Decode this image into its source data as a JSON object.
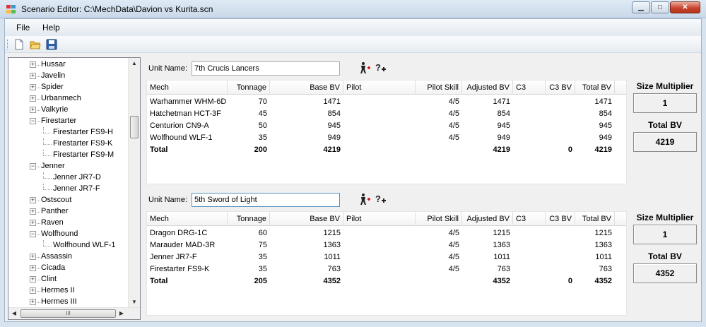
{
  "window": {
    "title": "Scenario Editor: C:\\MechData\\Davion vs Kurita.scn",
    "min_glyph": "▁",
    "max_glyph": "□",
    "close_glyph": "✕"
  },
  "menu": {
    "file": "File",
    "help": "Help"
  },
  "toolbar": {
    "icons": [
      "new-document-icon",
      "open-folder-icon",
      "save-disk-icon"
    ]
  },
  "tree": {
    "items": [
      {
        "label": "Hussar",
        "level": 0,
        "state": "collapsed"
      },
      {
        "label": "Javelin",
        "level": 0,
        "state": "collapsed"
      },
      {
        "label": "Spider",
        "level": 0,
        "state": "collapsed"
      },
      {
        "label": "Urbanmech",
        "level": 0,
        "state": "collapsed"
      },
      {
        "label": "Valkyrie",
        "level": 0,
        "state": "collapsed"
      },
      {
        "label": "Firestarter",
        "level": 0,
        "state": "expanded"
      },
      {
        "label": "Firestarter FS9-H",
        "level": 1,
        "state": "leaf"
      },
      {
        "label": "Firestarter FS9-K",
        "level": 1,
        "state": "leaf"
      },
      {
        "label": "Firestarter FS9-M",
        "level": 1,
        "state": "leaf"
      },
      {
        "label": "Jenner",
        "level": 0,
        "state": "expanded"
      },
      {
        "label": "Jenner JR7-D",
        "level": 1,
        "state": "leaf"
      },
      {
        "label": "Jenner JR7-F",
        "level": 1,
        "state": "leaf"
      },
      {
        "label": "Ostscout",
        "level": 0,
        "state": "collapsed"
      },
      {
        "label": "Panther",
        "level": 0,
        "state": "collapsed"
      },
      {
        "label": "Raven",
        "level": 0,
        "state": "collapsed"
      },
      {
        "label": "Wolfhound",
        "level": 0,
        "state": "expanded"
      },
      {
        "label": "Wolfhound WLF-1",
        "level": 1,
        "state": "leaf"
      },
      {
        "label": "Assassin",
        "level": 0,
        "state": "collapsed"
      },
      {
        "label": "Cicada",
        "level": 0,
        "state": "collapsed"
      },
      {
        "label": "Clint",
        "level": 0,
        "state": "collapsed"
      },
      {
        "label": "Hermes II",
        "level": 0,
        "state": "collapsed"
      },
      {
        "label": "Hermes III",
        "level": 0,
        "state": "collapsed"
      }
    ],
    "hscroll_grip": "III"
  },
  "columns": [
    "Mech",
    "Tonnage",
    "Base BV",
    "Pilot",
    "Pilot Skill",
    "Adjusted BV",
    "C3",
    "C3 BV",
    "Total BV"
  ],
  "units": [
    {
      "label": "Unit Name:",
      "name": "7th Crucis Lancers",
      "rows": [
        {
          "mech": "Warhammer WHM-6D",
          "tonnage": "70",
          "base_bv": "1471",
          "pilot": "",
          "skill": "4/5",
          "adj_bv": "1471",
          "c3": "",
          "c3_bv": "",
          "total_bv": "1471"
        },
        {
          "mech": "Hatchetman HCT-3F",
          "tonnage": "45",
          "base_bv": "854",
          "pilot": "",
          "skill": "4/5",
          "adj_bv": "854",
          "c3": "",
          "c3_bv": "",
          "total_bv": "854"
        },
        {
          "mech": "Centurion CN9-A",
          "tonnage": "50",
          "base_bv": "945",
          "pilot": "",
          "skill": "4/5",
          "adj_bv": "945",
          "c3": "",
          "c3_bv": "",
          "total_bv": "945"
        },
        {
          "mech": "Wolfhound WLF-1",
          "tonnage": "35",
          "base_bv": "949",
          "pilot": "",
          "skill": "4/5",
          "adj_bv": "949",
          "c3": "",
          "c3_bv": "",
          "total_bv": "949"
        }
      ],
      "total": {
        "mech": "Total",
        "tonnage": "200",
        "base_bv": "4219",
        "pilot": "",
        "skill": "",
        "adj_bv": "4219",
        "c3": "",
        "c3_bv": "0",
        "total_bv": "4219"
      },
      "size_multiplier_label": "Size Multiplier",
      "size_multiplier": "1",
      "total_bv_label": "Total BV",
      "total_bv": "4219"
    },
    {
      "label": "Unit Name:",
      "name": "5th Sword of Light",
      "rows": [
        {
          "mech": "Dragon DRG-1C",
          "tonnage": "60",
          "base_bv": "1215",
          "pilot": "",
          "skill": "4/5",
          "adj_bv": "1215",
          "c3": "",
          "c3_bv": "",
          "total_bv": "1215"
        },
        {
          "mech": "Marauder MAD-3R",
          "tonnage": "75",
          "base_bv": "1363",
          "pilot": "",
          "skill": "4/5",
          "adj_bv": "1363",
          "c3": "",
          "c3_bv": "",
          "total_bv": "1363"
        },
        {
          "mech": "Jenner JR7-F",
          "tonnage": "35",
          "base_bv": "1011",
          "pilot": "",
          "skill": "4/5",
          "adj_bv": "1011",
          "c3": "",
          "c3_bv": "",
          "total_bv": "1011"
        },
        {
          "mech": "Firestarter FS9-K",
          "tonnage": "35",
          "base_bv": "763",
          "pilot": "",
          "skill": "4/5",
          "adj_bv": "763",
          "c3": "",
          "c3_bv": "",
          "total_bv": "763"
        }
      ],
      "total": {
        "mech": "Total",
        "tonnage": "205",
        "base_bv": "4352",
        "pilot": "",
        "skill": "",
        "adj_bv": "4352",
        "c3": "",
        "c3_bv": "0",
        "total_bv": "4352"
      },
      "size_multiplier_label": "Size Multiplier",
      "size_multiplier": "1",
      "total_bv_label": "Total BV",
      "total_bv": "4352"
    }
  ],
  "colors": {
    "accent": "#5794bf",
    "icon_red": "#d42020"
  }
}
